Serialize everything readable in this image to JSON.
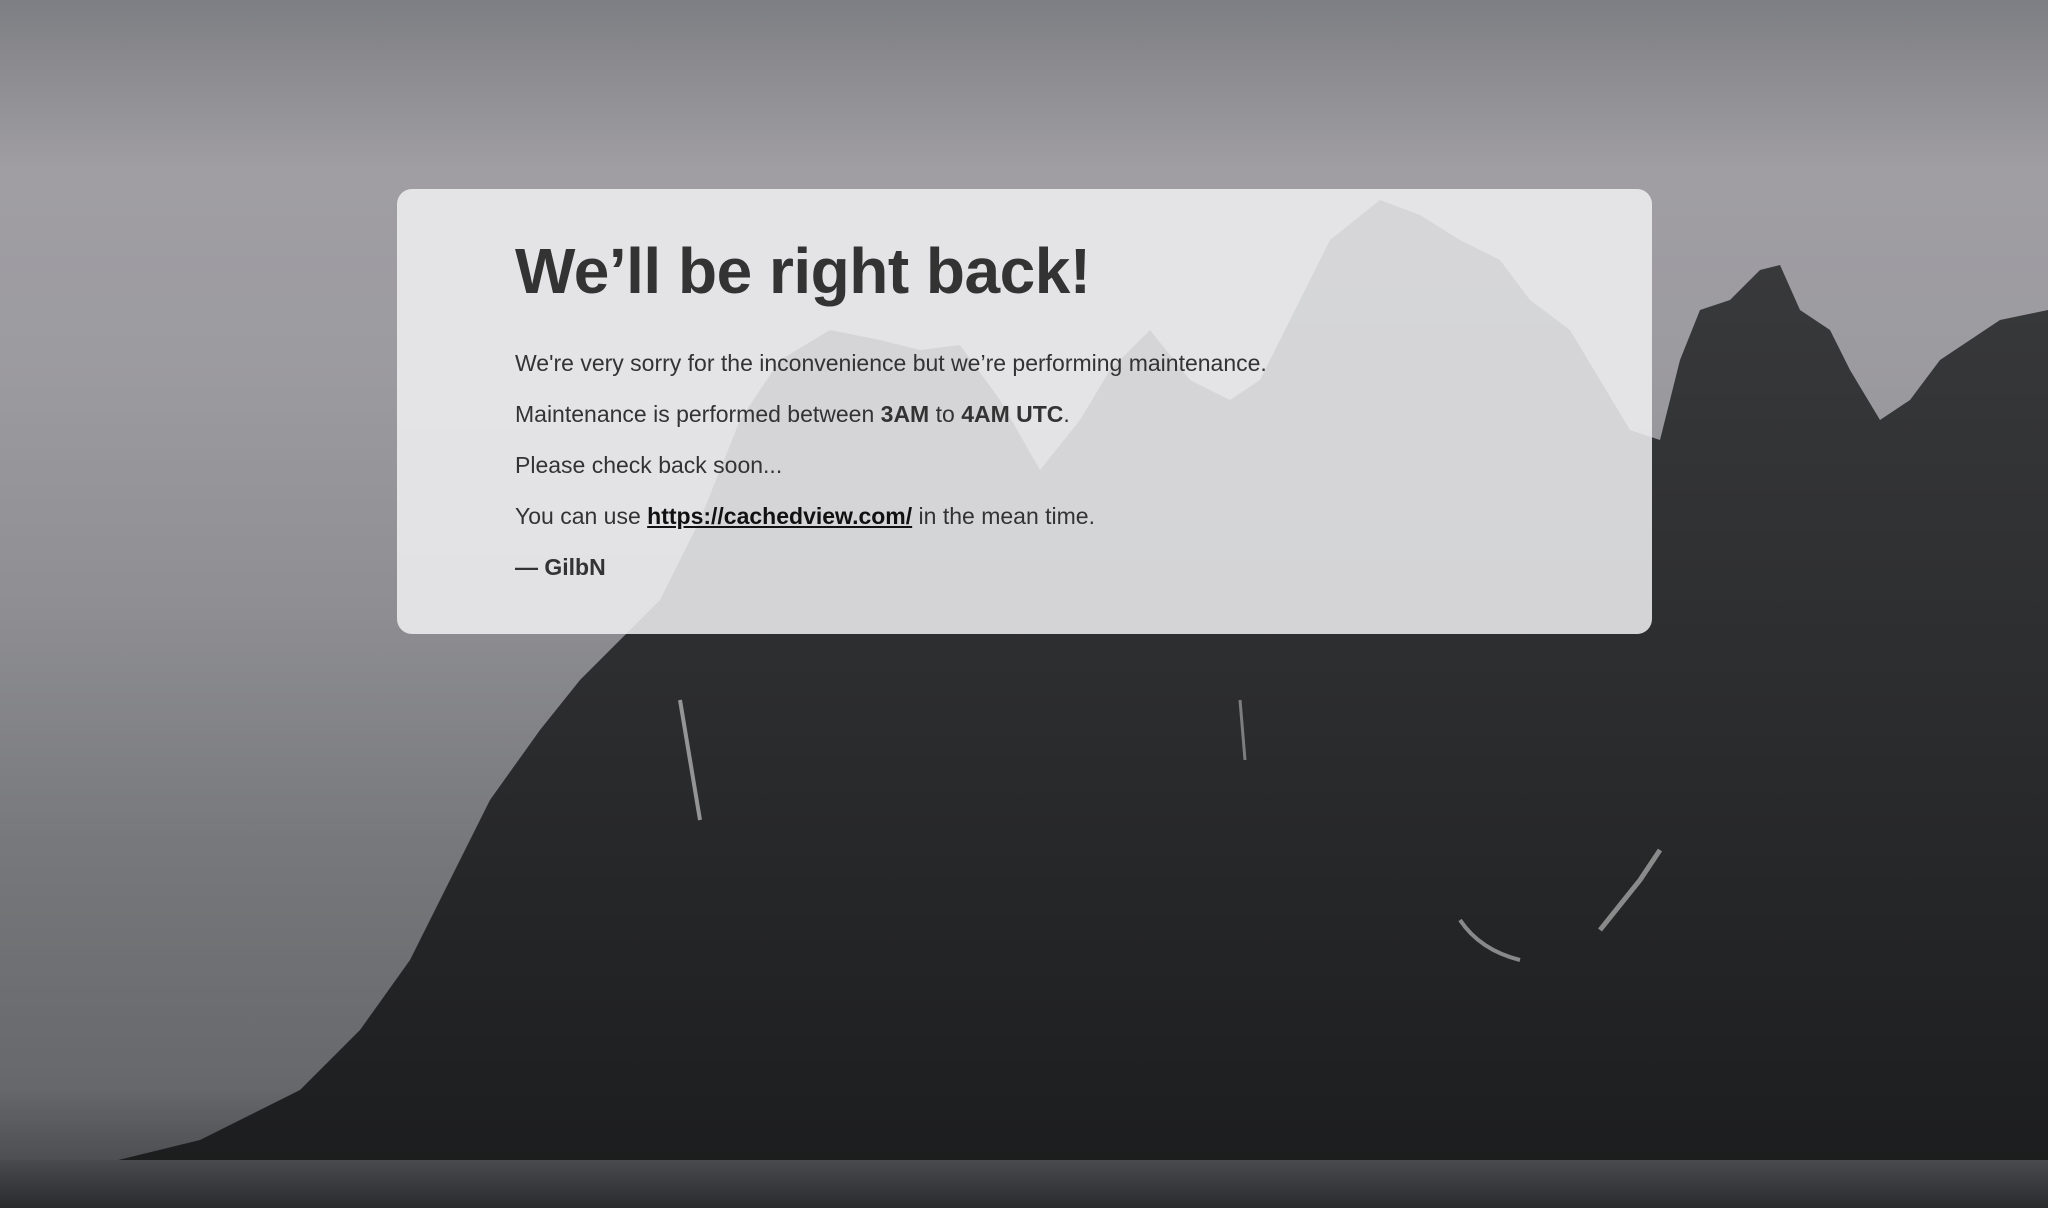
{
  "heading": "We’ll be right back!",
  "line1": "We're very sorry for the inconvenience but we’re performing maintenance.",
  "line2": {
    "prefix": "Maintenance is performed between ",
    "start_time": "3AM",
    "middle": " to ",
    "end_time": "4AM UTC",
    "suffix": "."
  },
  "line3": "Please check back soon...",
  "line4": {
    "prefix": "You can use ",
    "link_text": "https://cachedview.com/",
    "suffix": " in the mean time."
  },
  "signature": "— GilbN",
  "colors": {
    "card_background": "#f0f0f2",
    "text": "#333333"
  }
}
